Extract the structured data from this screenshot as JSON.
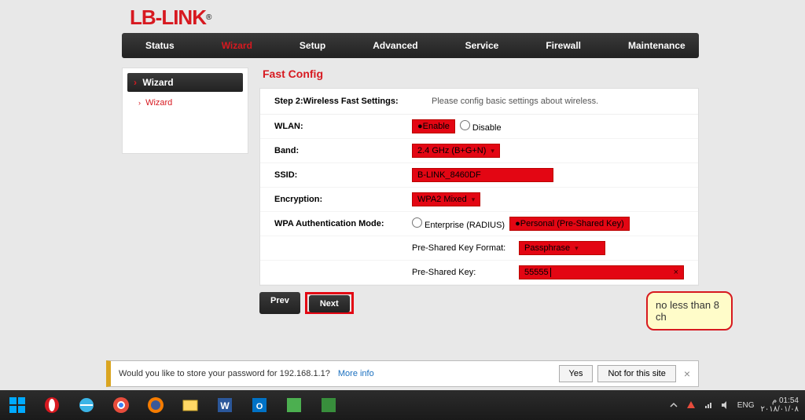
{
  "brand": "LB-LINK",
  "nav": [
    "Status",
    "Wizard",
    "Setup",
    "Advanced",
    "Service",
    "Firewall",
    "Maintenance"
  ],
  "nav_active_index": 1,
  "sidebar": {
    "head": "Wizard",
    "items": [
      "Wizard"
    ]
  },
  "title": "Fast Config",
  "step": {
    "label": "Step 2:Wireless Fast Settings:",
    "desc": "Please config basic settings about wireless."
  },
  "form": {
    "wlan_label": "WLAN:",
    "wlan_enable": "Enable",
    "wlan_disable": "Disable",
    "band_label": "Band:",
    "band_value": "2.4 GHz (B+G+N)",
    "ssid_label": "SSID:",
    "ssid_value": "B-LINK_8460DF",
    "enc_label": "Encryption:",
    "enc_value": "WPA2 Mixed",
    "auth_label": "WPA Authentication Mode:",
    "auth_enterprise": "Enterprise (RADIUS)",
    "auth_personal": "Personal (Pre-Shared Key)",
    "psk_format_label": "Pre-Shared Key Format:",
    "psk_format_value": "Passphrase",
    "psk_label": "Pre-Shared Key:",
    "psk_value": "55555"
  },
  "buttons": {
    "prev": "Prev",
    "next": "Next"
  },
  "callout": "no less than 8 ch",
  "savebar": {
    "msg_prefix": "Would you like to store your password for ",
    "host": "192.168.1.1",
    "msg_suffix": "?",
    "more": "More info",
    "yes": "Yes",
    "no": "Not for this site"
  },
  "tray": {
    "lang": "ENG",
    "time": "01:54 م",
    "date": "٢٠١٨/٠١/٠٨"
  }
}
